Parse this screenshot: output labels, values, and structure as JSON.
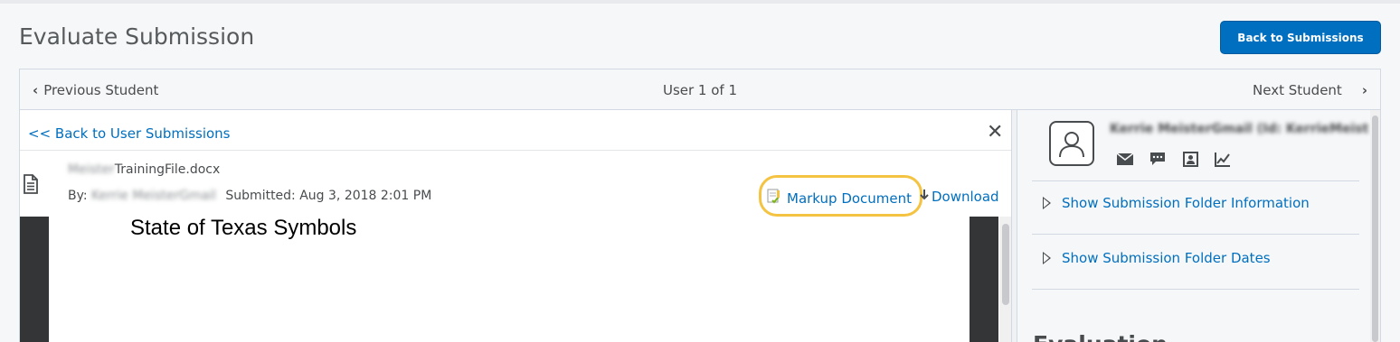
{
  "header": {
    "title": "Evaluate Submission",
    "back_button": "Back to Submissions"
  },
  "nav": {
    "previous": "Previous Student",
    "position": "User 1 of 1",
    "next": "Next Student"
  },
  "submission": {
    "back_link": "<< Back to User Submissions",
    "file_name_prefix": "Meister",
    "file_name": "TrainingFile.docx",
    "by_label": "By:",
    "by_name": "Kerrie MeisterGmail",
    "submitted": "Submitted: Aug 3, 2018 2:01 PM",
    "markup_link": "Markup Document",
    "download_link": "Download"
  },
  "viewer": {
    "heading": "State of Texas Symbols"
  },
  "user_panel": {
    "name": "Kerrie MeisterGmail (Id: KerrieMeist",
    "show_folder_info": "Show Submission Folder Information",
    "show_folder_dates": "Show Submission Folder Dates",
    "evaluation_heading": "Evaluation"
  },
  "colors": {
    "link": "#006fbf",
    "primary_button": "#006fbf",
    "highlight_ring": "#f5c342"
  }
}
